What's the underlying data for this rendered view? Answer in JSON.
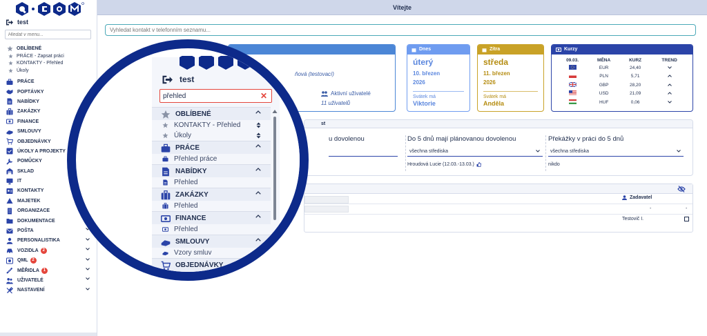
{
  "app": {
    "logo_text": "Q·COM",
    "window_title": "Vítejte",
    "user": "test"
  },
  "sidebar": {
    "search_placeholder": "Hledat v menu...",
    "favorites_title": "OBLÍBENÉ",
    "favorites": [
      "PRÁCE - Zapsat práci",
      "KONTAKTY - Přehled",
      "Úkoly"
    ],
    "items": [
      {
        "label": "PRÁCE",
        "icon": "briefcase-icon"
      },
      {
        "label": "POPTÁVKY",
        "icon": "handshake-icon"
      },
      {
        "label": "NABÍDKY",
        "icon": "document-icon"
      },
      {
        "label": "ZAKÁZKY",
        "icon": "suitcase-icon"
      },
      {
        "label": "FINANCE",
        "icon": "banknote-icon"
      },
      {
        "label": "SMLOUVY",
        "icon": "contract-icon"
      },
      {
        "label": "OBJEDNÁVKY",
        "icon": "cart-icon"
      },
      {
        "label": "ÚKOLY A PROJEKTY",
        "icon": "tasks-icon"
      },
      {
        "label": "POMŮCKY",
        "icon": "tools-icon"
      },
      {
        "label": "SKLAD",
        "icon": "warehouse-icon"
      },
      {
        "label": "IT",
        "icon": "monitor-icon"
      },
      {
        "label": "KONTAKTY",
        "icon": "contacts-icon"
      },
      {
        "label": "MAJETEK",
        "icon": "asset-icon"
      },
      {
        "label": "ORGANIZACE",
        "icon": "building-icon"
      },
      {
        "label": "DOKUMENTACE",
        "icon": "folder-icon"
      },
      {
        "label": "POŠTA",
        "icon": "mail-icon"
      },
      {
        "label": "PERSONALISTIKA",
        "icon": "person-icon"
      },
      {
        "label": "VOZIDLA",
        "icon": "car-icon",
        "badge": "2"
      },
      {
        "label": "QML",
        "icon": "qml-icon",
        "badge": "2"
      },
      {
        "label": "MĚŘIDLA",
        "icon": "gauge-icon",
        "badge": "1"
      },
      {
        "label": "UŽIVATELÉ",
        "icon": "users-icon"
      },
      {
        "label": "NASTAVENÍ",
        "icon": "settings-icon"
      }
    ]
  },
  "main": {
    "phone_search_placeholder": "Vyhledat kontakt v telefonním seznamu...",
    "welcome": {
      "subtitle": "ňová (testovací)",
      "active_users_label": "Aktivní uživatelé",
      "active_users_count": "11 uživatelů"
    },
    "today": {
      "header": "Dnes",
      "day": "úterý",
      "date_line1": "10. březen",
      "date_line2": "2026",
      "svatek_label": "Svátek má",
      "svatek_name": "Viktorie"
    },
    "tomorrow": {
      "header": "Zítra",
      "day": "středa",
      "date_line1": "11. březen",
      "date_line2": "2026",
      "svatek_label": "Svátek má",
      "svatek_name": "Anděla"
    },
    "rates": {
      "header": "Kurzy",
      "columns": [
        "09.03.",
        "MĚNA",
        "KURZ",
        "TREND"
      ],
      "rows": [
        {
          "currency": "EUR",
          "rate": "24,40",
          "trend": "down",
          "flag": "eu"
        },
        {
          "currency": "PLN",
          "rate": "5,71",
          "trend": "up",
          "flag": "pl"
        },
        {
          "currency": "GBP",
          "rate": "28,20",
          "trend": "up",
          "flag": "gb"
        },
        {
          "currency": "USD",
          "rate": "21,09",
          "trend": "up",
          "flag": "us"
        },
        {
          "currency": "HUF",
          "rate": "0,06",
          "trend": "down",
          "flag": "hu"
        }
      ]
    },
    "absence": {
      "header_fragment": "st",
      "col1_title": "u dovolenou",
      "col2_title": "Do 5 dnů mají plánovanou dovolenou",
      "col2_select": "všechna střediska",
      "col2_value": "Hroudová Lucie (12.03.-13.03.)",
      "col3_title": "Překážky v práci do 5 dnů",
      "col3_select": "všechna střediska",
      "col3_value": "nikdo"
    },
    "tasks": {
      "zadavatel_label": "Zadavatel",
      "row1_zadavatel": "-",
      "row1_end": "-",
      "row2_zadavatel": "Testovič I."
    }
  },
  "magnifier": {
    "user": "test",
    "search_value": "přehled",
    "sections": [
      {
        "title": "OBLÍBENÉ",
        "icon": "star-icon",
        "items": [
          "KONTAKTY - Přehled",
          "Úkoly"
        ]
      },
      {
        "title": "PRÁCE",
        "icon": "briefcase-icon",
        "items": [
          "Přehled práce"
        ]
      },
      {
        "title": "NABÍDKY",
        "icon": "document-icon",
        "items": [
          "Přehled"
        ]
      },
      {
        "title": "ZAKÁZKY",
        "icon": "suitcase-icon",
        "items": [
          "Přehled"
        ]
      },
      {
        "title": "FINANCE",
        "icon": "banknote-icon",
        "items": [
          "Přehled"
        ]
      },
      {
        "title": "SMLOUVY",
        "icon": "contract-icon",
        "items": [
          "Vzory smluv"
        ]
      }
    ],
    "cut_off_label": "OBJEDNÁVKY"
  },
  "colors": {
    "navy": "#0d2a8a",
    "today": "#6f9cf0",
    "tomorrow": "#c9a227",
    "rates": "#2b44a8",
    "welcome": "#4b86d6",
    "badge": "#e4453b"
  }
}
